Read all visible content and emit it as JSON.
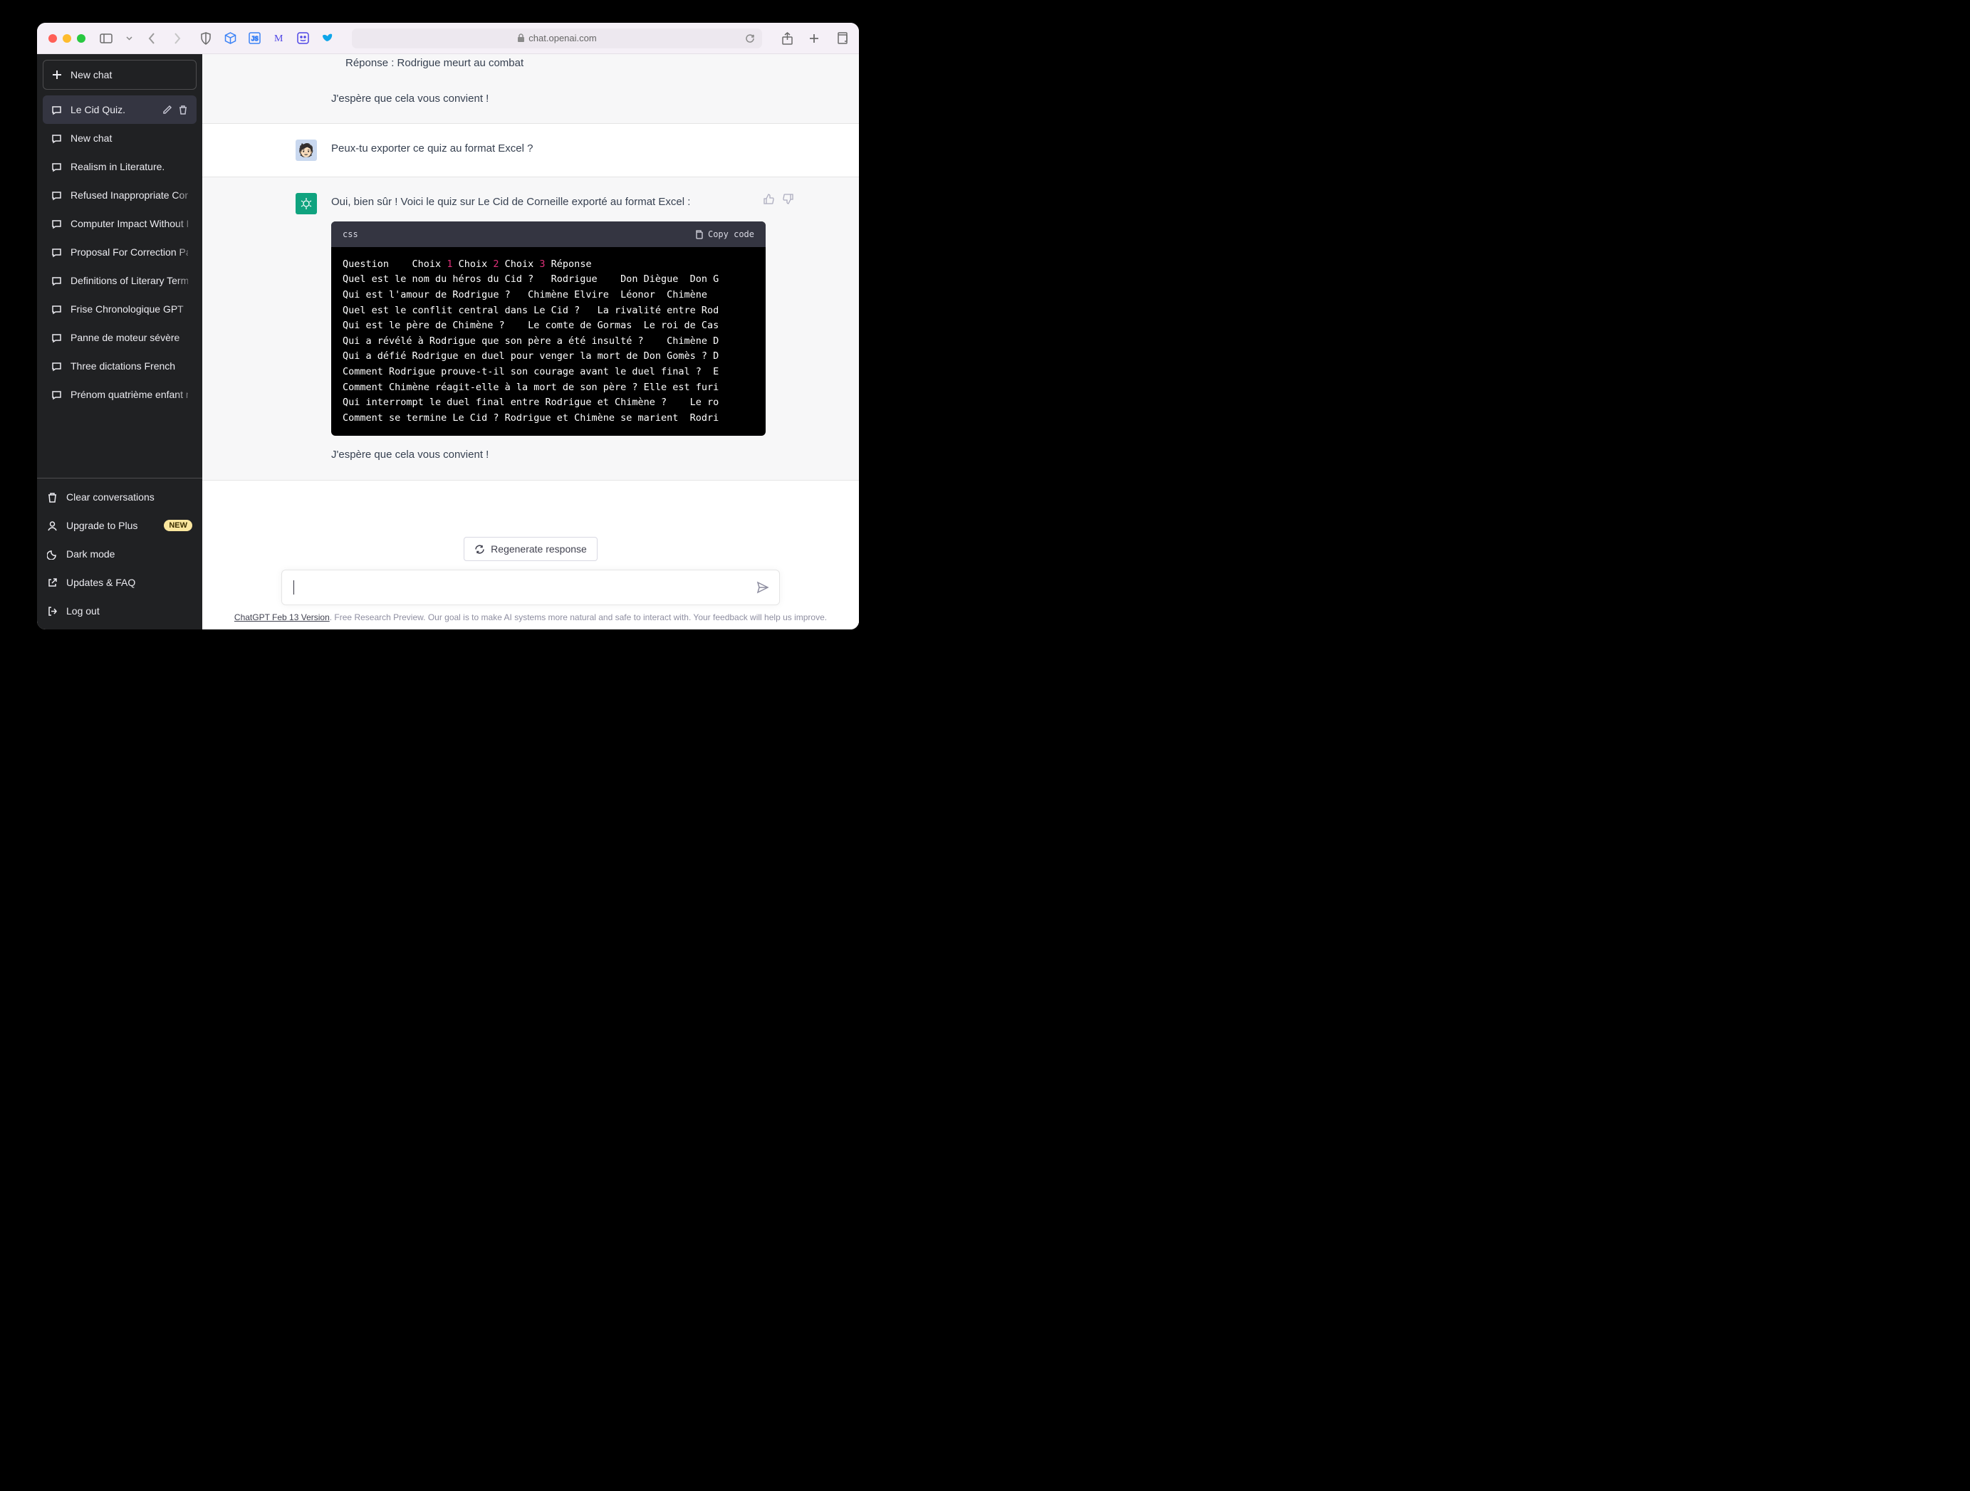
{
  "browser": {
    "url": "chat.openai.com"
  },
  "sidebar": {
    "new_chat": "New chat",
    "conversations": [
      {
        "label": "Le Cid Quiz.",
        "active": true
      },
      {
        "label": "New chat"
      },
      {
        "label": "Realism in Literature."
      },
      {
        "label": "Refused Inappropriate Content"
      },
      {
        "label": "Computer Impact Without People"
      },
      {
        "label": "Proposal For Correction Paragraph"
      },
      {
        "label": "Definitions of Literary Terms"
      },
      {
        "label": "Frise Chronologique GPT"
      },
      {
        "label": "Panne de moteur sévère"
      },
      {
        "label": "Three dictations French"
      },
      {
        "label": "Prénom quatrième enfant maman"
      }
    ],
    "bottom": {
      "clear": "Clear conversations",
      "upgrade": "Upgrade to Plus",
      "badge": "NEW",
      "darkmode": "Dark mode",
      "faq": "Updates & FAQ",
      "logout": "Log out"
    }
  },
  "chat": {
    "prev_bot_line1": "Réponse : Rodrigue meurt au combat",
    "prev_bot_line2": "J'espère que cela vous convient !",
    "user_msg": "Peux-tu exporter ce quiz au format Excel ?",
    "bot_intro": "Oui, bien sûr ! Voici le quiz sur Le Cid de Corneille exporté au format Excel :",
    "code_lang": "css",
    "copy_label": "Copy code",
    "code_lines": [
      {
        "pre": "Question    Choix ",
        "n1": "1",
        "mid1": " Choix ",
        "n2": "2",
        "mid2": " Choix ",
        "n3": "3",
        "post": " Réponse"
      },
      {
        "text": "Quel est le nom du héros du Cid ?   Rodrigue    Don Diègue  Don G"
      },
      {
        "text": "Qui est l'amour de Rodrigue ?   Chimène Elvire  Léonor  Chimène"
      },
      {
        "text": "Quel est le conflit central dans Le Cid ?   La rivalité entre Rod"
      },
      {
        "text": "Qui est le père de Chimène ?    Le comte de Gormas  Le roi de Cas"
      },
      {
        "text": "Qui a révélé à Rodrigue que son père a été insulté ?    Chimène D"
      },
      {
        "text": "Qui a défié Rodrigue en duel pour venger la mort de Don Gomès ? D"
      },
      {
        "text": "Comment Rodrigue prouve-t-il son courage avant le duel final ?  E"
      },
      {
        "text": "Comment Chimène réagit-elle à la mort de son père ? Elle est furi"
      },
      {
        "text": "Qui interrompt le duel final entre Rodrigue et Chimène ?    Le ro"
      },
      {
        "text": "Comment se termine Le Cid ? Rodrigue et Chimène se marient  Rodri"
      }
    ],
    "bot_outro": "J'espère que cela vous convient !"
  },
  "input": {
    "regenerate": "Regenerate response",
    "placeholder": ""
  },
  "footer": {
    "version": "ChatGPT Feb 13 Version",
    "rest": ". Free Research Preview. Our goal is to make AI systems more natural and safe to interact with. Your feedback will help us improve."
  }
}
